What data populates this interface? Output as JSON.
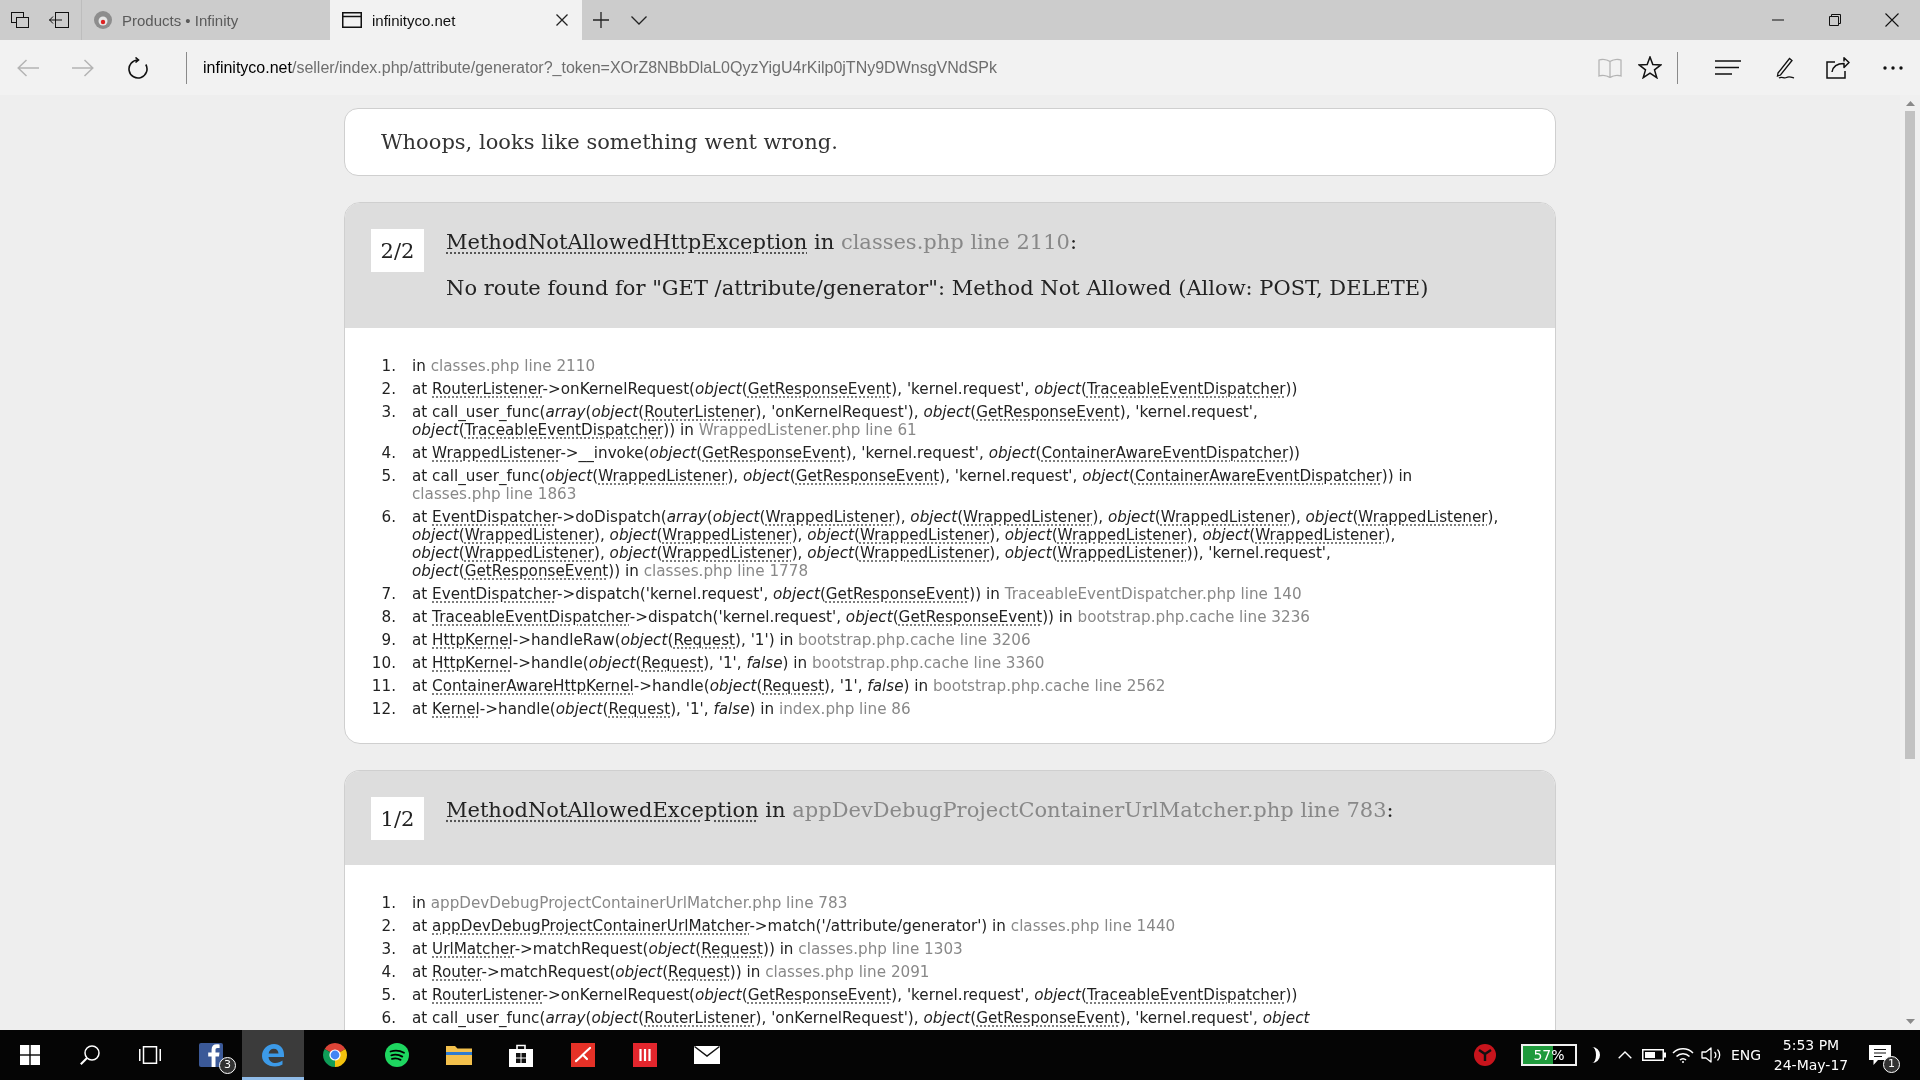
{
  "browser": {
    "tabs": [
      {
        "kind": "favicon",
        "title": "Products • Infinity",
        "selected": false
      },
      {
        "kind": "page",
        "title": "infinityco.net",
        "selected": true
      }
    ],
    "nav": [
      {
        "kind": "back",
        "disabled": true
      },
      {
        "kind": "forward",
        "disabled": true
      },
      {
        "kind": "refresh",
        "disabled": false
      }
    ],
    "address": {
      "host": "infinityco.net",
      "path": "/seller/index.php/attribute/generator?_token=XOrZ8NBbDlaL0QyzYigU4rKilp0jTNy9DWnsgVNdSPk"
    },
    "actions": [
      {
        "kind": "reading-view",
        "disabled": true
      },
      {
        "kind": "favorite",
        "disabled": false
      },
      {
        "kind": "hub",
        "disabled": false
      },
      {
        "kind": "note",
        "disabled": false
      },
      {
        "kind": "share",
        "disabled": false
      },
      {
        "kind": "more",
        "disabled": false
      }
    ]
  },
  "page": {
    "heading": "Whoops, looks like something went wrong.",
    "exceptions": [
      {
        "counter": "2/2",
        "title": [
          {
            "kind": "class",
            "text": "MethodNotAllowedHttpException"
          },
          {
            "kind": "plain",
            "text": " in "
          },
          {
            "kind": "file",
            "text": "classes.php line 2110"
          },
          {
            "kind": "plain",
            "text": ":"
          }
        ],
        "message": "No route found for \"GET /attribute/generator\": Method Not Allowed (Allow: POST, DELETE)",
        "trace": [
          {
            "number": "1.",
            "parts": [
              {
                "kind": "plain",
                "text": "in "
              },
              {
                "kind": "file",
                "text": "classes.php line 2110"
              }
            ]
          },
          {
            "number": "2.",
            "parts": [
              {
                "kind": "plain",
                "text": "at "
              },
              {
                "kind": "class",
                "text": "RouterListener"
              },
              {
                "kind": "plain",
                "text": "->onKernelRequest("
              },
              {
                "kind": "italic",
                "text": "object"
              },
              {
                "kind": "plain",
                "text": "("
              },
              {
                "kind": "class",
                "text": "GetResponseEvent"
              },
              {
                "kind": "plain",
                "text": "), 'kernel.request', "
              },
              {
                "kind": "italic",
                "text": "object"
              },
              {
                "kind": "plain",
                "text": "("
              },
              {
                "kind": "class",
                "text": "TraceableEventDispatcher"
              },
              {
                "kind": "plain",
                "text": "))"
              }
            ]
          },
          {
            "number": "3.",
            "parts": [
              {
                "kind": "plain",
                "text": "at call_user_func("
              },
              {
                "kind": "italic",
                "text": "array"
              },
              {
                "kind": "plain",
                "text": "("
              },
              {
                "kind": "italic",
                "text": "object"
              },
              {
                "kind": "plain",
                "text": "("
              },
              {
                "kind": "class",
                "text": "RouterListener"
              },
              {
                "kind": "plain",
                "text": "), 'onKernelRequest'), "
              },
              {
                "kind": "italic",
                "text": "object"
              },
              {
                "kind": "plain",
                "text": "("
              },
              {
                "kind": "class",
                "text": "GetResponseEvent"
              },
              {
                "kind": "plain",
                "text": "), 'kernel.request', "
              },
              {
                "kind": "italic",
                "text": "object"
              },
              {
                "kind": "plain",
                "text": "("
              },
              {
                "kind": "class",
                "text": "TraceableEventDispatcher"
              },
              {
                "kind": "plain",
                "text": ")) in "
              },
              {
                "kind": "file",
                "text": "WrappedListener.php line 61"
              }
            ]
          },
          {
            "number": "4.",
            "parts": [
              {
                "kind": "plain",
                "text": "at "
              },
              {
                "kind": "class",
                "text": "WrappedListener"
              },
              {
                "kind": "plain",
                "text": "->__invoke("
              },
              {
                "kind": "italic",
                "text": "object"
              },
              {
                "kind": "plain",
                "text": "("
              },
              {
                "kind": "class",
                "text": "GetResponseEvent"
              },
              {
                "kind": "plain",
                "text": "), 'kernel.request', "
              },
              {
                "kind": "italic",
                "text": "object"
              },
              {
                "kind": "plain",
                "text": "("
              },
              {
                "kind": "class",
                "text": "ContainerAwareEventDispatcher"
              },
              {
                "kind": "plain",
                "text": "))"
              }
            ]
          },
          {
            "number": "5.",
            "parts": [
              {
                "kind": "plain",
                "text": "at call_user_func("
              },
              {
                "kind": "italic",
                "text": "object"
              },
              {
                "kind": "plain",
                "text": "("
              },
              {
                "kind": "class",
                "text": "WrappedListener"
              },
              {
                "kind": "plain",
                "text": "), "
              },
              {
                "kind": "italic",
                "text": "object"
              },
              {
                "kind": "plain",
                "text": "("
              },
              {
                "kind": "class",
                "text": "GetResponseEvent"
              },
              {
                "kind": "plain",
                "text": "), 'kernel.request', "
              },
              {
                "kind": "italic",
                "text": "object"
              },
              {
                "kind": "plain",
                "text": "("
              },
              {
                "kind": "class",
                "text": "ContainerAwareEventDispatcher"
              },
              {
                "kind": "plain",
                "text": ")) in "
              },
              {
                "kind": "file",
                "text": "classes.php line 1863"
              }
            ]
          },
          {
            "number": "6.",
            "parts": [
              {
                "kind": "plain",
                "text": "at "
              },
              {
                "kind": "class",
                "text": "EventDispatcher"
              },
              {
                "kind": "plain",
                "text": "->doDispatch("
              },
              {
                "kind": "italic",
                "text": "array"
              },
              {
                "kind": "plain",
                "text": "("
              },
              {
                "kind": "italic",
                "text": "object"
              },
              {
                "kind": "plain",
                "text": "("
              },
              {
                "kind": "class",
                "text": "WrappedListener"
              },
              {
                "kind": "plain",
                "text": "), "
              },
              {
                "kind": "italic",
                "text": "object"
              },
              {
                "kind": "plain",
                "text": "("
              },
              {
                "kind": "class",
                "text": "WrappedListener"
              },
              {
                "kind": "plain",
                "text": "), "
              },
              {
                "kind": "italic",
                "text": "object"
              },
              {
                "kind": "plain",
                "text": "("
              },
              {
                "kind": "class",
                "text": "WrappedListener"
              },
              {
                "kind": "plain",
                "text": "), "
              },
              {
                "kind": "italic",
                "text": "object"
              },
              {
                "kind": "plain",
                "text": "("
              },
              {
                "kind": "class",
                "text": "WrappedListener"
              },
              {
                "kind": "plain",
                "text": "), "
              },
              {
                "kind": "italic",
                "text": "object"
              },
              {
                "kind": "plain",
                "text": "("
              },
              {
                "kind": "class",
                "text": "WrappedListener"
              },
              {
                "kind": "plain",
                "text": "), "
              },
              {
                "kind": "italic",
                "text": "object"
              },
              {
                "kind": "plain",
                "text": "("
              },
              {
                "kind": "class",
                "text": "WrappedListener"
              },
              {
                "kind": "plain",
                "text": "), "
              },
              {
                "kind": "italic",
                "text": "object"
              },
              {
                "kind": "plain",
                "text": "("
              },
              {
                "kind": "class",
                "text": "WrappedListener"
              },
              {
                "kind": "plain",
                "text": "), "
              },
              {
                "kind": "italic",
                "text": "object"
              },
              {
                "kind": "plain",
                "text": "("
              },
              {
                "kind": "class",
                "text": "WrappedListener"
              },
              {
                "kind": "plain",
                "text": "), "
              },
              {
                "kind": "italic",
                "text": "object"
              },
              {
                "kind": "plain",
                "text": "("
              },
              {
                "kind": "class",
                "text": "WrappedListener"
              },
              {
                "kind": "plain",
                "text": "), "
              },
              {
                "kind": "italic",
                "text": "object"
              },
              {
                "kind": "plain",
                "text": "("
              },
              {
                "kind": "class",
                "text": "WrappedListener"
              },
              {
                "kind": "plain",
                "text": "), "
              },
              {
                "kind": "italic",
                "text": "object"
              },
              {
                "kind": "plain",
                "text": "("
              },
              {
                "kind": "class",
                "text": "WrappedListener"
              },
              {
                "kind": "plain",
                "text": "), "
              },
              {
                "kind": "italic",
                "text": "object"
              },
              {
                "kind": "plain",
                "text": "("
              },
              {
                "kind": "class",
                "text": "WrappedListener"
              },
              {
                "kind": "plain",
                "text": "), "
              },
              {
                "kind": "italic",
                "text": "object"
              },
              {
                "kind": "plain",
                "text": "("
              },
              {
                "kind": "class",
                "text": "WrappedListener"
              },
              {
                "kind": "plain",
                "text": ")), 'kernel.request', "
              },
              {
                "kind": "italic",
                "text": "object"
              },
              {
                "kind": "plain",
                "text": "("
              },
              {
                "kind": "class",
                "text": "GetResponseEvent"
              },
              {
                "kind": "plain",
                "text": ")) in "
              },
              {
                "kind": "file",
                "text": "classes.php line 1778"
              }
            ]
          },
          {
            "number": "7.",
            "parts": [
              {
                "kind": "plain",
                "text": "at "
              },
              {
                "kind": "class",
                "text": "EventDispatcher"
              },
              {
                "kind": "plain",
                "text": "->dispatch('kernel.request', "
              },
              {
                "kind": "italic",
                "text": "object"
              },
              {
                "kind": "plain",
                "text": "("
              },
              {
                "kind": "class",
                "text": "GetResponseEvent"
              },
              {
                "kind": "plain",
                "text": ")) in "
              },
              {
                "kind": "file",
                "text": "TraceableEventDispatcher.php line 140"
              }
            ]
          },
          {
            "number": "8.",
            "parts": [
              {
                "kind": "plain",
                "text": "at "
              },
              {
                "kind": "class",
                "text": "TraceableEventDispatcher"
              },
              {
                "kind": "plain",
                "text": "->dispatch('kernel.request', "
              },
              {
                "kind": "italic",
                "text": "object"
              },
              {
                "kind": "plain",
                "text": "("
              },
              {
                "kind": "class",
                "text": "GetResponseEvent"
              },
              {
                "kind": "plain",
                "text": ")) in "
              },
              {
                "kind": "file",
                "text": "bootstrap.php.cache line 3236"
              }
            ]
          },
          {
            "number": "9.",
            "parts": [
              {
                "kind": "plain",
                "text": "at "
              },
              {
                "kind": "class",
                "text": "HttpKernel"
              },
              {
                "kind": "plain",
                "text": "->handleRaw("
              },
              {
                "kind": "italic",
                "text": "object"
              },
              {
                "kind": "plain",
                "text": "("
              },
              {
                "kind": "class",
                "text": "Request"
              },
              {
                "kind": "plain",
                "text": "), '1') in "
              },
              {
                "kind": "file",
                "text": "bootstrap.php.cache line 3206"
              }
            ]
          },
          {
            "number": "10.",
            "parts": [
              {
                "kind": "plain",
                "text": "at "
              },
              {
                "kind": "class",
                "text": "HttpKernel"
              },
              {
                "kind": "plain",
                "text": "->handle("
              },
              {
                "kind": "italic",
                "text": "object"
              },
              {
                "kind": "plain",
                "text": "("
              },
              {
                "kind": "class",
                "text": "Request"
              },
              {
                "kind": "plain",
                "text": "), '1', "
              },
              {
                "kind": "italic",
                "text": "false"
              },
              {
                "kind": "plain",
                "text": ") in "
              },
              {
                "kind": "file",
                "text": "bootstrap.php.cache line 3360"
              }
            ]
          },
          {
            "number": "11.",
            "parts": [
              {
                "kind": "plain",
                "text": "at "
              },
              {
                "kind": "class",
                "text": "ContainerAwareHttpKernel"
              },
              {
                "kind": "plain",
                "text": "->handle("
              },
              {
                "kind": "italic",
                "text": "object"
              },
              {
                "kind": "plain",
                "text": "("
              },
              {
                "kind": "class",
                "text": "Request"
              },
              {
                "kind": "plain",
                "text": "), '1', "
              },
              {
                "kind": "italic",
                "text": "false"
              },
              {
                "kind": "plain",
                "text": ") in "
              },
              {
                "kind": "file",
                "text": "bootstrap.php.cache line 2562"
              }
            ]
          },
          {
            "number": "12.",
            "parts": [
              {
                "kind": "plain",
                "text": "at "
              },
              {
                "kind": "class",
                "text": "Kernel"
              },
              {
                "kind": "plain",
                "text": "->handle("
              },
              {
                "kind": "italic",
                "text": "object"
              },
              {
                "kind": "plain",
                "text": "("
              },
              {
                "kind": "class",
                "text": "Request"
              },
              {
                "kind": "plain",
                "text": "), '1', "
              },
              {
                "kind": "italic",
                "text": "false"
              },
              {
                "kind": "plain",
                "text": ") in "
              },
              {
                "kind": "file",
                "text": "index.php line 86"
              }
            ]
          }
        ]
      },
      {
        "counter": "1/2",
        "title": [
          {
            "kind": "class",
            "text": "MethodNotAllowedException"
          },
          {
            "kind": "plain",
            "text": " in "
          },
          {
            "kind": "file",
            "text": "appDevDebugProjectContainerUrlMatcher.php line 783"
          },
          {
            "kind": "plain",
            "text": ":"
          }
        ],
        "trace": [
          {
            "number": "1.",
            "parts": [
              {
                "kind": "plain",
                "text": "in "
              },
              {
                "kind": "file",
                "text": "appDevDebugProjectContainerUrlMatcher.php line 783"
              }
            ]
          },
          {
            "number": "2.",
            "parts": [
              {
                "kind": "plain",
                "text": "at "
              },
              {
                "kind": "class",
                "text": "appDevDebugProjectContainerUrlMatcher"
              },
              {
                "kind": "plain",
                "text": "->match('/attribute/generator') in "
              },
              {
                "kind": "file",
                "text": "classes.php line 1440"
              }
            ]
          },
          {
            "number": "3.",
            "parts": [
              {
                "kind": "plain",
                "text": "at "
              },
              {
                "kind": "class",
                "text": "UrlMatcher"
              },
              {
                "kind": "plain",
                "text": "->matchRequest("
              },
              {
                "kind": "italic",
                "text": "object"
              },
              {
                "kind": "plain",
                "text": "("
              },
              {
                "kind": "class",
                "text": "Request"
              },
              {
                "kind": "plain",
                "text": ")) in "
              },
              {
                "kind": "file",
                "text": "classes.php line 1303"
              }
            ]
          },
          {
            "number": "4.",
            "parts": [
              {
                "kind": "plain",
                "text": "at "
              },
              {
                "kind": "class",
                "text": "Router"
              },
              {
                "kind": "plain",
                "text": "->matchRequest("
              },
              {
                "kind": "italic",
                "text": "object"
              },
              {
                "kind": "plain",
                "text": "("
              },
              {
                "kind": "class",
                "text": "Request"
              },
              {
                "kind": "plain",
                "text": ")) in "
              },
              {
                "kind": "file",
                "text": "classes.php line 2091"
              }
            ]
          },
          {
            "number": "5.",
            "parts": [
              {
                "kind": "plain",
                "text": "at "
              },
              {
                "kind": "class",
                "text": "RouterListener"
              },
              {
                "kind": "plain",
                "text": "->onKernelRequest("
              },
              {
                "kind": "italic",
                "text": "object"
              },
              {
                "kind": "plain",
                "text": "("
              },
              {
                "kind": "class",
                "text": "GetResponseEvent"
              },
              {
                "kind": "plain",
                "text": "), 'kernel.request', "
              },
              {
                "kind": "italic",
                "text": "object"
              },
              {
                "kind": "plain",
                "text": "("
              },
              {
                "kind": "class",
                "text": "TraceableEventDispatcher"
              },
              {
                "kind": "plain",
                "text": "))"
              }
            ]
          },
          {
            "number": "6.",
            "parts": [
              {
                "kind": "plain",
                "text": "at call_user_func("
              },
              {
                "kind": "italic",
                "text": "array"
              },
              {
                "kind": "plain",
                "text": "("
              },
              {
                "kind": "italic",
                "text": "object"
              },
              {
                "kind": "plain",
                "text": "("
              },
              {
                "kind": "class",
                "text": "RouterListener"
              },
              {
                "kind": "plain",
                "text": "), 'onKernelRequest'), "
              },
              {
                "kind": "italic",
                "text": "object"
              },
              {
                "kind": "plain",
                "text": "("
              },
              {
                "kind": "class",
                "text": "GetResponseEvent"
              },
              {
                "kind": "plain",
                "text": "), 'kernel.request', "
              },
              {
                "kind": "italic",
                "text": "object"
              }
            ]
          }
        ]
      }
    ]
  },
  "taskbar": {
    "apps": [
      {
        "kind": "start",
        "selected": false
      },
      {
        "kind": "search",
        "selected": false
      },
      {
        "kind": "task-view",
        "selected": false
      },
      {
        "kind": "facebook",
        "selected": false,
        "badge": "3"
      },
      {
        "kind": "edge",
        "selected": true
      },
      {
        "kind": "chrome",
        "selected": false
      },
      {
        "kind": "spotify",
        "selected": false
      },
      {
        "kind": "explorer",
        "selected": false
      },
      {
        "kind": "store",
        "selected": false
      },
      {
        "kind": "red-pen",
        "selected": false
      },
      {
        "kind": "red-bars",
        "selected": false
      },
      {
        "kind": "mail",
        "selected": false
      }
    ],
    "tray": {
      "battery": {
        "reading": "57%",
        "level": 0.57
      },
      "language": "ENG",
      "time": "5:53 PM",
      "date": "24-May-17",
      "notifications": "1"
    }
  }
}
